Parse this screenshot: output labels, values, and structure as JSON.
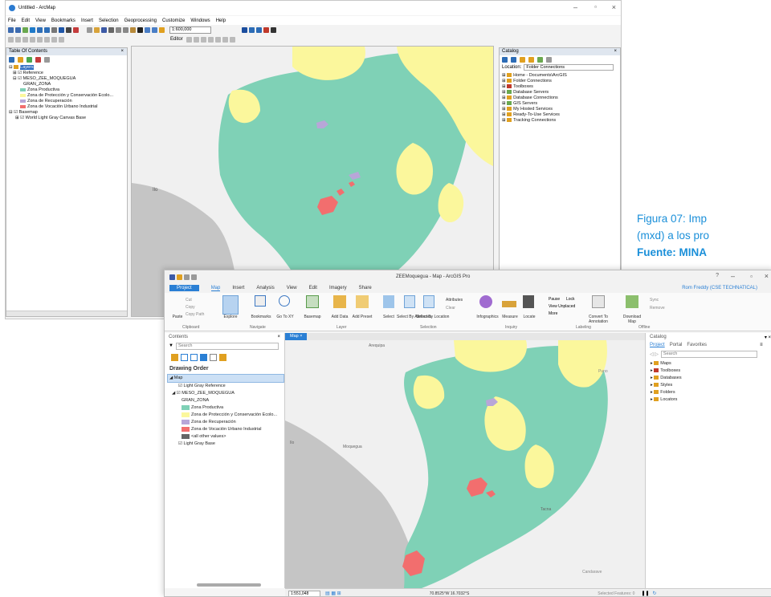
{
  "arcmap": {
    "title": "Untitled - ArcMap",
    "menus": [
      "File",
      "Edit",
      "View",
      "Bookmarks",
      "Insert",
      "Selection",
      "Geoprocessing",
      "Customize",
      "Windows",
      "Help"
    ],
    "scale": "1:600,000",
    "editor_label": "Editor",
    "toc": {
      "header": "Table Of Contents",
      "items": [
        "Layers",
        "Reference",
        "MESO_ZEE_MOQUEGUA",
        "GRAN_ZONA",
        "Zona Productiva",
        "Zona de Protección y Conservación Ecolo...",
        "Zona de Recuperación",
        "Zona de Vocación Urbano Industrial",
        "Basemap",
        "World Light Gray Canvas Base"
      ]
    },
    "catalog": {
      "header": "Catalog",
      "location_label": "Location:",
      "location_value": "Folder Connections",
      "items": [
        "Home - Documents\\ArcGIS",
        "Folder Connections",
        "Toolboxes",
        "Database Servers",
        "Database Connections",
        "GIS Servers",
        "My Hosted Services",
        "Ready-To-Use Services",
        "Tracking Connections"
      ]
    },
    "map_labels": [
      "Ilo"
    ]
  },
  "caption": {
    "line1": "Figura 07: Imp",
    "line2": "(mxd) a los pro",
    "source": "Fuente: MINA"
  },
  "pro": {
    "title": "ZEEMoquegua - Map - ArcGIS Pro",
    "user": "Rom Freddy (CSE TECHNATICAL)",
    "tabs": [
      "Project",
      "Map",
      "Insert",
      "Analysis",
      "View",
      "Edit",
      "Imagery",
      "Share"
    ],
    "ribbon": {
      "clipboard": [
        "Cut",
        "Copy",
        "Paste",
        "Copy Path"
      ],
      "navigate": [
        "Explore",
        "Bookmarks",
        "Go To XY"
      ],
      "layer": [
        "Basemap",
        "Add Data",
        "Add Preset"
      ],
      "selection": [
        "Select",
        "Select By Attributes",
        "Select By Location",
        "Attributes",
        "Clear"
      ],
      "inquiry": [
        "Infographics",
        "Measure",
        "Locate"
      ],
      "labeling": [
        "Pause",
        "Lock",
        "View Unplaced",
        "More",
        "Convert To Annotation"
      ],
      "offline": [
        "Download Map",
        "Sync",
        "Remove"
      ],
      "groups": [
        "Clipboard",
        "Navigate",
        "Layer",
        "Selection",
        "Inquiry",
        "Labeling",
        "Offline"
      ]
    },
    "contents": {
      "header": "Contents",
      "search_placeholder": "Search",
      "drawing_order": "Drawing Order",
      "items": [
        "Map",
        "Light Gray Reference",
        "MESO_ZEE_MOQUEGUA",
        "GRAN_ZONA",
        "Zona Productiva",
        "Zona de Protección y Conservación Ecolo...",
        "Zona de Recuperación",
        "Zona de Vocación Urbano Industrial",
        "<all other values>",
        "Light Gray Base"
      ]
    },
    "map_tab": "Map",
    "map_labels": [
      "Arequipa",
      "Ilo",
      "Tacna",
      "Moquegua",
      "Candarave",
      "Puno"
    ],
    "catalog": {
      "header": "Catalog",
      "tabs": [
        "Project",
        "Portal",
        "Favorites"
      ],
      "search_placeholder": "Search",
      "items": [
        "Maps",
        "Toolboxes",
        "Databases",
        "Styles",
        "Folders",
        "Locators"
      ]
    },
    "status": {
      "scale": "1:551,048",
      "coords": "70.8525°W 16.7032°S",
      "selected": "Selected Features: 0"
    }
  },
  "colors": {
    "zone_productiva": "#7fd1b6",
    "zone_proteccion": "#fbf79c",
    "zone_recuperacion": "#b8a6d8",
    "zone_urbano": "#f26e6e",
    "ocean": "#c5c5c5",
    "land": "#f0f0f0",
    "caption": "#1a8fd9",
    "pro_accent": "#2a7fd4"
  }
}
